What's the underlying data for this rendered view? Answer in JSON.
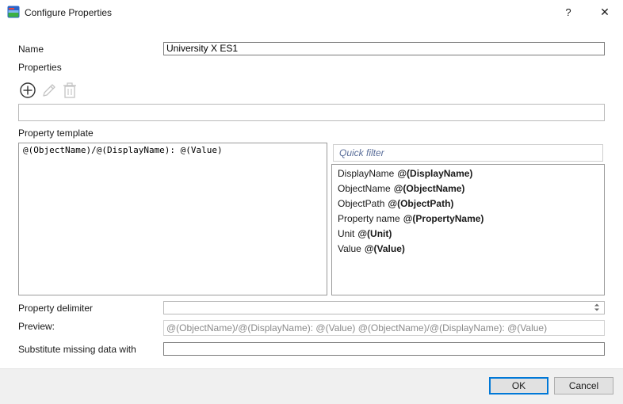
{
  "window": {
    "title": "Configure Properties",
    "help_label": "?",
    "close_label": "✕"
  },
  "name_field": {
    "label": "Name",
    "value": "University X ES1"
  },
  "properties": {
    "label": "Properties",
    "toolbar": {
      "add_icon": "circle-plus-icon",
      "edit_icon": "pencil-icon",
      "delete_icon": "trash-icon"
    },
    "value": ""
  },
  "template": {
    "label": "Property template",
    "value": "@(ObjectName)/@(DisplayName): @(Value)"
  },
  "quick_filter": {
    "placeholder": "Quick filter"
  },
  "variables": [
    {
      "label": "DisplayName",
      "token": "@(DisplayName)"
    },
    {
      "label": "ObjectName",
      "token": "@(ObjectName)"
    },
    {
      "label": "ObjectPath",
      "token": "@(ObjectPath)"
    },
    {
      "label": "Property name",
      "token": "@(PropertyName)"
    },
    {
      "label": "Unit",
      "token": "@(Unit)"
    },
    {
      "label": "Value",
      "token": "@(Value)"
    }
  ],
  "delimiter": {
    "label": "Property delimiter",
    "value": ""
  },
  "preview": {
    "label": "Preview:",
    "value": "@(ObjectName)/@(DisplayName): @(Value)  @(ObjectName)/@(DisplayName): @(Value)"
  },
  "substitute": {
    "label": "Substitute missing data with",
    "value": ""
  },
  "buttons": {
    "ok": "OK",
    "cancel": "Cancel"
  },
  "colors": {
    "accent": "#0078d7",
    "placeholder_text": "#5a6e9a",
    "footer_bg": "#f0f0f0"
  }
}
